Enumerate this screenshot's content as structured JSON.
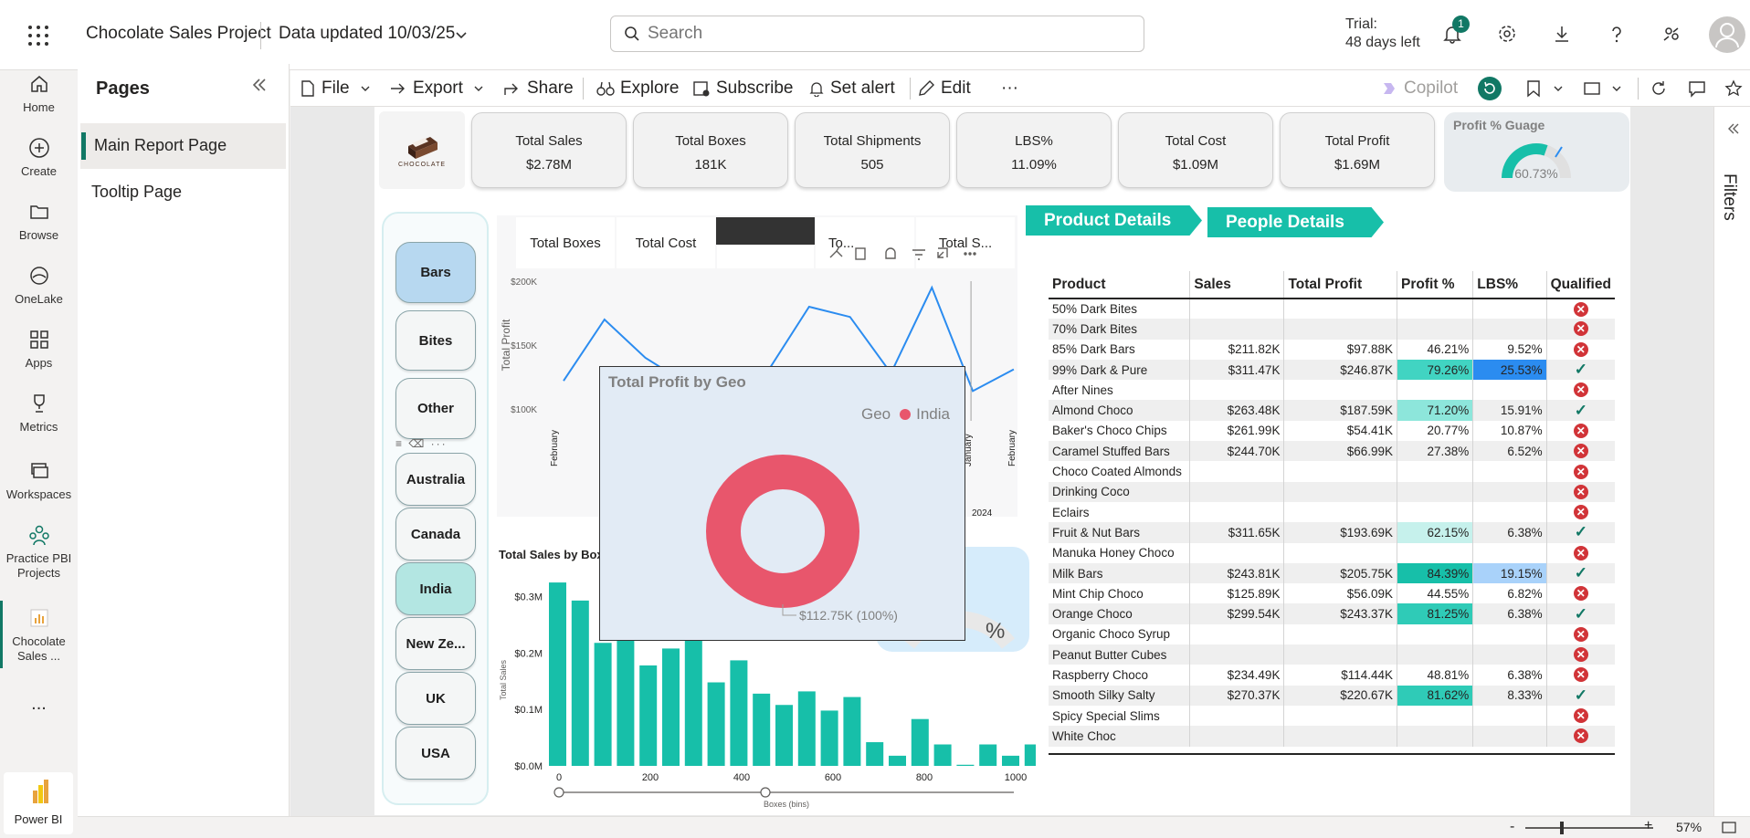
{
  "app": {
    "name": "Power BI"
  },
  "header": {
    "report_title": "Chocolate Sales Project",
    "data_updated": "Data updated 10/03/25",
    "search_placeholder": "Search",
    "trial_label": "Trial:",
    "trial_days": "48 days left",
    "notification_count": "1"
  },
  "left_rail": {
    "items": [
      {
        "label": "Home",
        "icon": "home-icon"
      },
      {
        "label": "Create",
        "icon": "create-icon"
      },
      {
        "label": "Browse",
        "icon": "browse-icon"
      },
      {
        "label": "OneLake",
        "icon": "onelake-icon"
      },
      {
        "label": "Apps",
        "icon": "apps-icon"
      },
      {
        "label": "Metrics",
        "icon": "metrics-icon"
      },
      {
        "label": "Workspaces",
        "icon": "workspaces-icon"
      },
      {
        "label": "Practice PBI Projects",
        "icon": "workspace-icon"
      },
      {
        "label": "Chocolate Sales ...",
        "icon": "report-icon"
      },
      {
        "label": "...",
        "icon": "more-icon"
      }
    ],
    "product_label": "Power BI"
  },
  "pages_pane": {
    "title": "Pages",
    "pages": [
      "Main Report Page",
      "Tooltip Page"
    ],
    "active_page": "Main Report Page"
  },
  "toolbar": {
    "file": "File",
    "export": "Export",
    "share": "Share",
    "explore": "Explore",
    "subscribe": "Subscribe",
    "set_alert": "Set alert",
    "edit": "Edit",
    "more": "···",
    "copilot": "Copilot"
  },
  "filters_pane": {
    "label": "Filters"
  },
  "logo": {
    "text": "CHOCOLATE"
  },
  "kpis": [
    {
      "title": "Total Sales",
      "value": "$2.78M"
    },
    {
      "title": "Total Boxes",
      "value": "181K"
    },
    {
      "title": "Total Shipments",
      "value": "505"
    },
    {
      "title": "LBS%",
      "value": "11.09%"
    },
    {
      "title": "Total Cost",
      "value": "$1.09M"
    },
    {
      "title": "Total Profit",
      "value": "$1.69M"
    }
  ],
  "gauge": {
    "title": "Profit % Guage",
    "value": "60.73%",
    "fraction": 0.6073
  },
  "slicer": {
    "groups": [
      [
        "Bars",
        "Bites",
        "Other"
      ],
      [
        "Australia",
        "Canada",
        "India",
        "New Ze...",
        "UK",
        "USA"
      ]
    ],
    "selected": [
      "Bars",
      "India"
    ]
  },
  "nav_buttons": {
    "product": "Product Details",
    "people": "People Details"
  },
  "line_chart": {
    "tabs": [
      "Total Boxes",
      "Total Cost",
      "",
      "To...",
      "Total S..."
    ],
    "ylabel": "Total Profit",
    "yticks": [
      "$200K",
      "$150K",
      "$100K"
    ],
    "xticks": [
      "February",
      "January",
      "February"
    ],
    "year": "2024",
    "chart_data": {
      "type": "line",
      "ylabel": "Total Profit",
      "ylim": [
        100000,
        200000
      ],
      "x": [
        "February",
        "",
        "",
        "",
        "",
        "",
        "",
        "",
        "",
        "",
        "January",
        "February"
      ],
      "values": [
        122000,
        170000,
        140000,
        120000,
        108000,
        130000,
        180000,
        172000,
        128000,
        195000,
        114000,
        131000
      ]
    }
  },
  "histogram": {
    "title": "Total Sales by Box",
    "ylabel": "Total Sales",
    "xlabel": "Boxes (bins)",
    "yticks": [
      "$0.3M",
      "$0.2M",
      "$0.1M",
      "$0.0M"
    ],
    "xticks": [
      "0",
      "200",
      "400",
      "600",
      "800",
      "1000"
    ],
    "gauge_partial": "%",
    "chart_data": {
      "type": "bar",
      "xlabel": "Boxes (bins)",
      "ylabel": "Total Sales",
      "ylim": [
        0,
        0.33
      ],
      "values": [
        0.325,
        0.293,
        0.218,
        0.228,
        0.178,
        0.208,
        0.222,
        0.148,
        0.187,
        0.128,
        0.108,
        0.132,
        0.098,
        0.122,
        0.042,
        0.018,
        0.083,
        0.038,
        0.002,
        0.038,
        0.018,
        0.038
      ]
    }
  },
  "tooltip": {
    "title": "Total Profit by Geo",
    "legend_label": "Geo",
    "legend_item": "India",
    "data_label": "$112.75K (100%)",
    "color": "#e8566c",
    "chart_data": {
      "type": "pie",
      "categories": [
        "India"
      ],
      "values": [
        112750
      ]
    }
  },
  "table": {
    "columns": [
      "Product",
      "Sales",
      "Total Profit",
      "Profit %",
      "LBS%",
      "Qualified"
    ],
    "rows": [
      {
        "product": "50% Dark Bites",
        "sales": "",
        "profit": "",
        "profit_pct": "",
        "lbs": "",
        "q": false
      },
      {
        "product": "70% Dark Bites",
        "sales": "",
        "profit": "",
        "profit_pct": "",
        "lbs": "",
        "q": false
      },
      {
        "product": "85% Dark Bars",
        "sales": "$211.82K",
        "profit": "$97.88K",
        "profit_pct": "46.21%",
        "lbs": "9.52%",
        "q": false
      },
      {
        "product": "99% Dark & Pure",
        "sales": "$311.47K",
        "profit": "$246.87K",
        "profit_pct": "79.26%",
        "lbs": "25.53%",
        "q": true,
        "pc": "#41d4c2",
        "lc": "#2b8cf0"
      },
      {
        "product": "After Nines",
        "sales": "",
        "profit": "",
        "profit_pct": "",
        "lbs": "",
        "q": false
      },
      {
        "product": "Almond Choco",
        "sales": "$263.48K",
        "profit": "$187.59K",
        "profit_pct": "71.20%",
        "lbs": "15.91%",
        "q": true,
        "pc": "#8de6db"
      },
      {
        "product": "Baker's Choco Chips",
        "sales": "$261.99K",
        "profit": "$54.41K",
        "profit_pct": "20.77%",
        "lbs": "10.87%",
        "q": false
      },
      {
        "product": "Caramel Stuffed Bars",
        "sales": "$244.70K",
        "profit": "$66.99K",
        "profit_pct": "27.38%",
        "lbs": "6.52%",
        "q": false
      },
      {
        "product": "Choco Coated Almonds",
        "sales": "",
        "profit": "",
        "profit_pct": "",
        "lbs": "",
        "q": false
      },
      {
        "product": "Drinking Coco",
        "sales": "",
        "profit": "",
        "profit_pct": "",
        "lbs": "",
        "q": false
      },
      {
        "product": "Eclairs",
        "sales": "",
        "profit": "",
        "profit_pct": "",
        "lbs": "",
        "q": false
      },
      {
        "product": "Fruit & Nut Bars",
        "sales": "$311.65K",
        "profit": "$193.69K",
        "profit_pct": "62.15%",
        "lbs": "6.38%",
        "q": true,
        "pc": "#c6f1ec"
      },
      {
        "product": "Manuka Honey Choco",
        "sales": "",
        "profit": "",
        "profit_pct": "",
        "lbs": "",
        "q": false
      },
      {
        "product": "Milk Bars",
        "sales": "$243.81K",
        "profit": "$205.75K",
        "profit_pct": "84.39%",
        "lbs": "19.15%",
        "q": true,
        "pc": "#17bfa9",
        "lc": "#a9d2fa"
      },
      {
        "product": "Mint Chip Choco",
        "sales": "$125.89K",
        "profit": "$56.09K",
        "profit_pct": "44.55%",
        "lbs": "6.82%",
        "q": false
      },
      {
        "product": "Orange Choco",
        "sales": "$299.54K",
        "profit": "$243.37K",
        "profit_pct": "81.25%",
        "lbs": "6.38%",
        "q": true,
        "pc": "#2fcbb7"
      },
      {
        "product": "Organic Choco Syrup",
        "sales": "",
        "profit": "",
        "profit_pct": "",
        "lbs": "",
        "q": false
      },
      {
        "product": "Peanut Butter Cubes",
        "sales": "",
        "profit": "",
        "profit_pct": "",
        "lbs": "",
        "q": false
      },
      {
        "product": "Raspberry Choco",
        "sales": "$234.49K",
        "profit": "$114.44K",
        "profit_pct": "48.81%",
        "lbs": "6.38%",
        "q": false
      },
      {
        "product": "Smooth Silky Salty",
        "sales": "$270.37K",
        "profit": "$220.67K",
        "profit_pct": "81.62%",
        "lbs": "8.33%",
        "q": true,
        "pc": "#2fcbb7"
      },
      {
        "product": "Spicy Special Slims",
        "sales": "",
        "profit": "",
        "profit_pct": "",
        "lbs": "",
        "q": false
      },
      {
        "product": "White Choc",
        "sales": "",
        "profit": "",
        "profit_pct": "",
        "lbs": "",
        "q": false
      }
    ]
  },
  "statusbar": {
    "minus": "-",
    "plus": "+",
    "zoom": "57%"
  },
  "colors": {
    "accent": "#117865",
    "teal": "#17bfa9",
    "line": "#2b8cf0",
    "tooltip_donut": "#e8566c"
  }
}
